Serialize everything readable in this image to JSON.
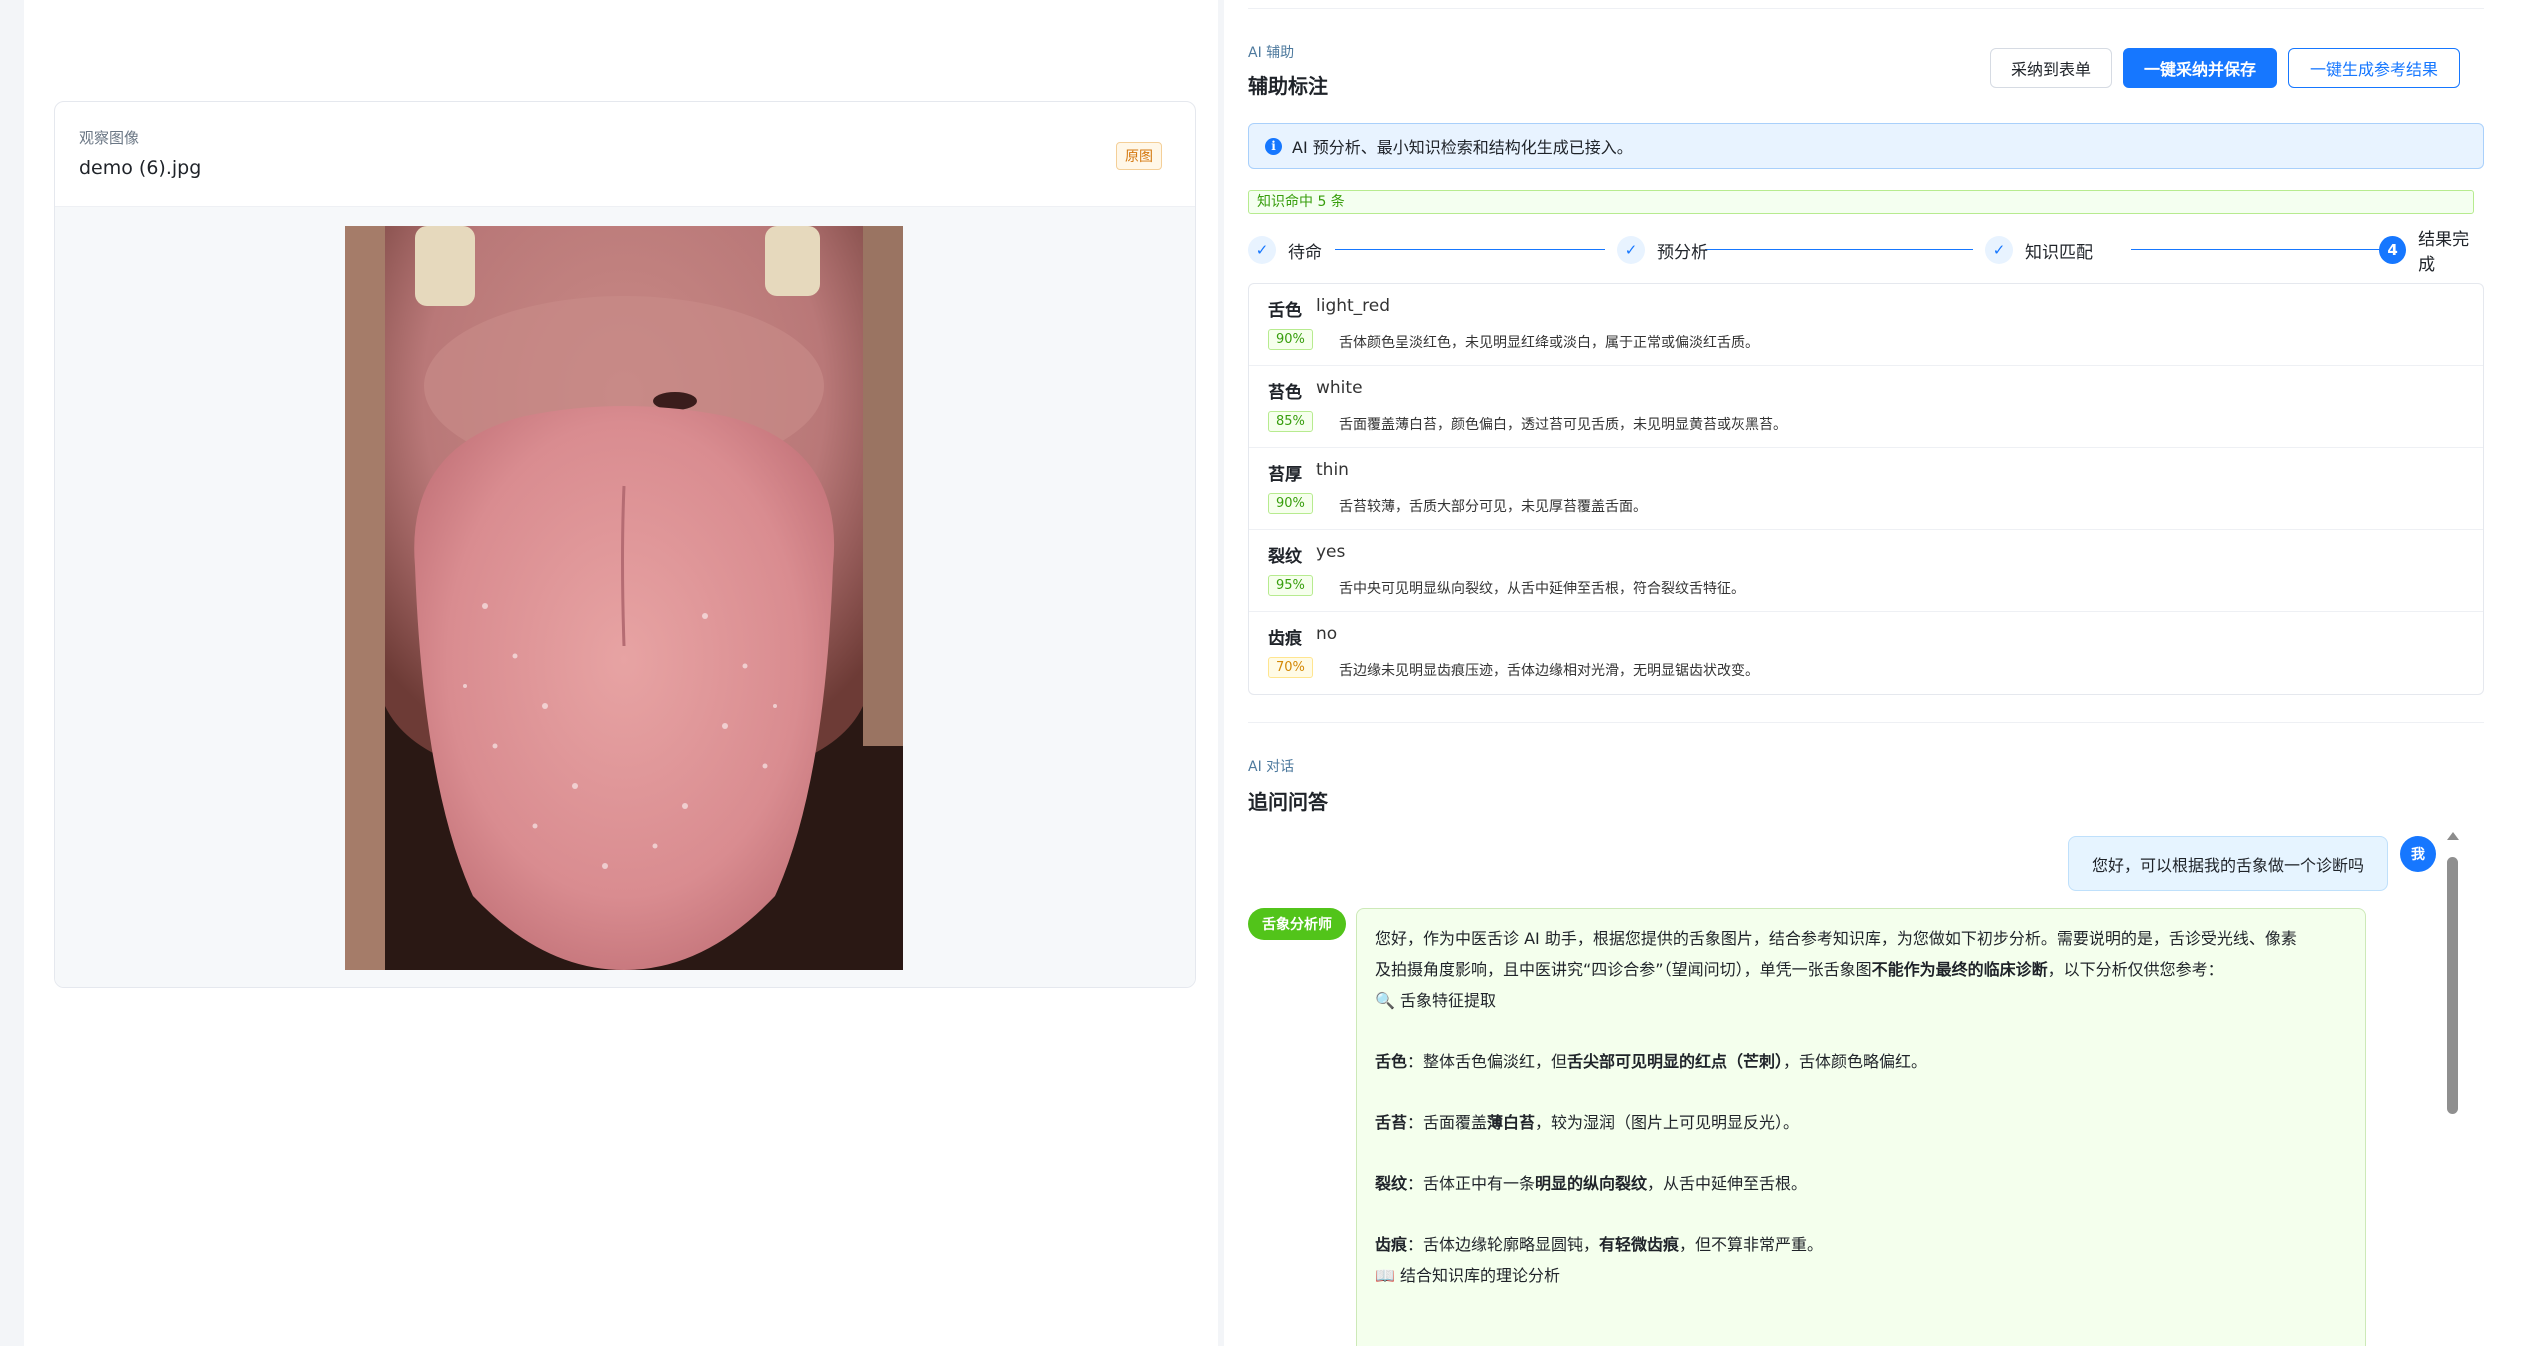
{
  "image_card": {
    "eyebrow": "观察图像",
    "filename": "demo (6).jpg",
    "tag": "原图"
  },
  "assist": {
    "eyebrow": "AI 辅助",
    "title": "辅助标注",
    "btn_adopt": "采纳到表单",
    "btn_adopt_save": "一键采纳并保存",
    "btn_generate": "一键生成参考结果",
    "alert": "AI 预分析、最小知识检索和结构化生成已接入。",
    "hit_tag": "知识命中 5 条",
    "steps": [
      {
        "label": "待命",
        "state": "done",
        "icon": "✓"
      },
      {
        "label": "预分析",
        "state": "done",
        "icon": "✓"
      },
      {
        "label": "知识匹配",
        "state": "done",
        "icon": "✓"
      },
      {
        "label": "结果完成",
        "state": "active",
        "icon": "4"
      }
    ],
    "results": [
      {
        "label": "舌色",
        "value": "light_red",
        "confidence": "90%",
        "level": "green",
        "desc": "舌体颜色呈淡红色，未见明显红绛或淡白，属于正常或偏淡红舌质。"
      },
      {
        "label": "苔色",
        "value": "white",
        "confidence": "85%",
        "level": "green",
        "desc": "舌面覆盖薄白苔，颜色偏白，透过苔可见舌质，未见明显黄苔或灰黑苔。"
      },
      {
        "label": "苔厚",
        "value": "thin",
        "confidence": "90%",
        "level": "green",
        "desc": "舌苔较薄，舌质大部分可见，未见厚苔覆盖舌面。"
      },
      {
        "label": "裂纹",
        "value": "yes",
        "confidence": "95%",
        "level": "green",
        "desc": "舌中央可见明显纵向裂纹，从舌中延伸至舌根，符合裂纹舌特征。"
      },
      {
        "label": "齿痕",
        "value": "no",
        "confidence": "70%",
        "level": "orange",
        "desc": "舌边缘未见明显齿痕压迹，舌体边缘相对光滑，无明显锯齿状改变。"
      }
    ]
  },
  "chat": {
    "eyebrow": "AI 对话",
    "title": "追问问答",
    "user_avatar": "我",
    "user_message": "您好，可以根据我的舌象做一个诊断吗",
    "bot_name": "舌象分析师",
    "bot": {
      "intro_1": "您好，作为中医舌诊 AI 助手，根据您提供的舌象图片，结合参考知识库，为您做如下初步分析。需要说明的是，舌诊受光线、像素",
      "intro_2a": "及拍摄角度影响，且中医讲究“四诊合参”（望闻问切），单凭一张舌象图",
      "intro_2b": "不能作为最终的临床诊断",
      "intro_2c": "，以下分析仅供您参考：",
      "section1": "🔍 舌象特征提取",
      "color_label": "舌色",
      "color_a": "：整体舌色偏淡红，但",
      "color_b": "舌尖部可见明显的红点（芒刺）",
      "color_c": "，舌体颜色略偏红。",
      "coat_label": "舌苔",
      "coat_a": "：舌面覆盖",
      "coat_b": "薄白苔",
      "coat_c": "，较为湿润（图片上可见明显反光）。",
      "crack_label": "裂纹",
      "crack_a": "：舌体正中有一条",
      "crack_b": "明显的纵向裂纹",
      "crack_c": "，从舌中延伸至舌根。",
      "teeth_label": "齿痕",
      "teeth_a": "：舌体边缘轮廓略显圆钝，",
      "teeth_b": "有轻微齿痕",
      "teeth_c": "，但不算非常严重。",
      "section2": "📖 结合知识库的理论分析"
    }
  }
}
